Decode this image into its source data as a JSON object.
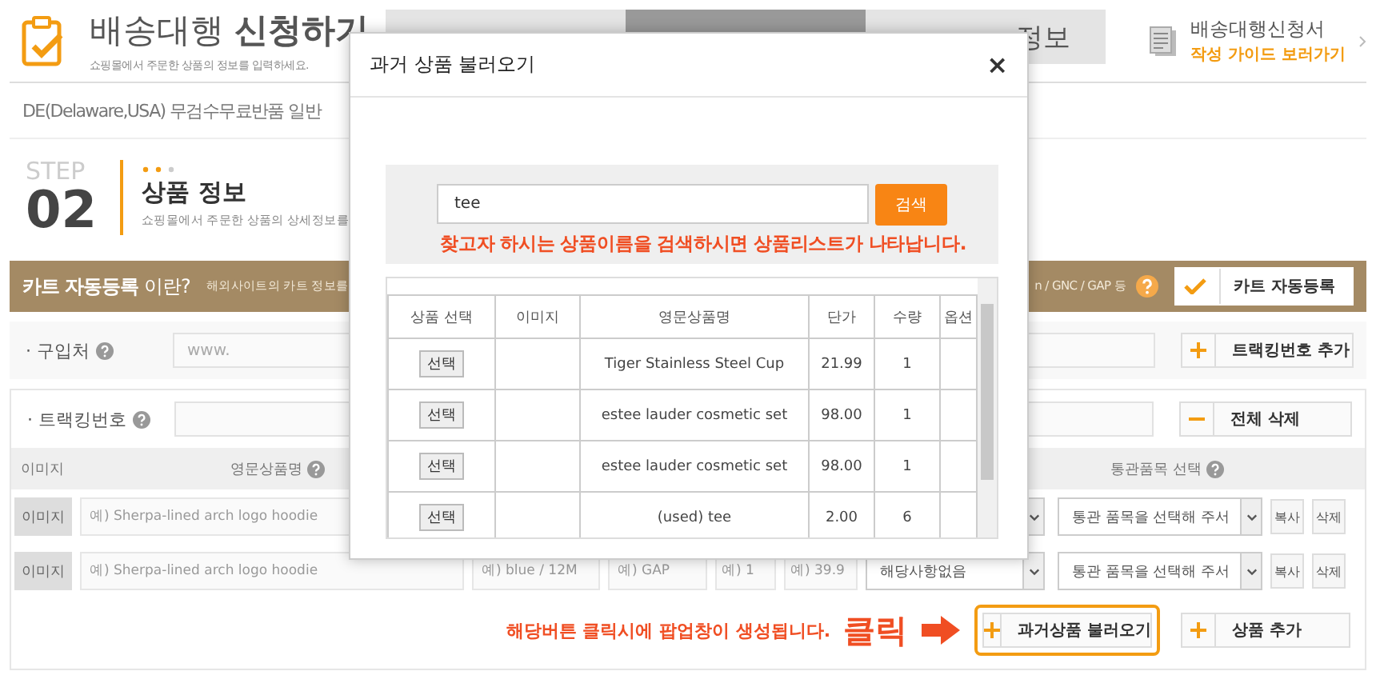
{
  "header": {
    "title": "배송대행 **신청하기**",
    "subtitle": "쇼핑몰에서 주문한 상품의 정보를 입력하세요."
  },
  "steps": [
    {
      "selected": false
    },
    {
      "selected": true
    },
    {
      "selected": false,
      "label": "정보"
    }
  ],
  "guide": {
    "title": "배송대행신청서",
    "link": "작성 가이드 보러가기"
  },
  "notice": "DE(Delaware,USA) 무검수무료반품 일반",
  "step": {
    "label": "STEP",
    "number": "02",
    "title": "상품 정보",
    "desc": "쇼핑몰에서 주문한 상품의 상세정보를"
  },
  "cart_bar": {
    "title": "**카트 자동등록** 이란?",
    "desc": "해외사이트의 카트 정보를",
    "sites": "n / GNC / GAP 등",
    "button": "카트 자동등록"
  },
  "store": {
    "label": "· 구입처",
    "placeholder": "www.",
    "button": "트랙킹번호 추가"
  },
  "tracking": {
    "label": "· 트랙킹번호",
    "button": "전체 삭제"
  },
  "columns": [
    "이미지",
    "영문상품명",
    "통관품목 선택"
  ],
  "products": [
    {
      "image_button": "이미지",
      "name_placeholder": "예) Sherpa-lined arch logo hoodie",
      "customs": "통관 품목을 선택해 주서",
      "copy": "복사",
      "delete": "삭제"
    },
    {
      "image_button": "이미지",
      "name_placeholder": "예) Sherpa-lined arch logo hoodie",
      "option_placeholder": "예) blue / 12M",
      "brand_placeholder": "예) GAP",
      "qty_placeholder": "예) 1",
      "price_placeholder": "예) 39.9",
      "extra": "해당사항없음",
      "customs": "통관 품목을 선택해 주서",
      "copy": "복사",
      "delete": "삭제"
    }
  ],
  "annotation": {
    "text": "해당버튼 클릭시에 팝업창이 생성됩니다.",
    "click": "클릭"
  },
  "actions": [
    {
      "label": "과거상품 불러오기",
      "highlighted": true
    },
    {
      "label": "상품 추가",
      "highlighted": false
    }
  ],
  "modal": {
    "title": "과거 상품 불러오기",
    "close": "×",
    "search_value": "tee",
    "search_button": "검색",
    "hint": "찾고자 하시는 상품이름을 검색하시면 상품리스트가 나타납니다.",
    "columns": [
      "상품 선택",
      "이미지",
      "영문상품명",
      "단가",
      "수량",
      "옵션"
    ],
    "rows": [
      {
        "select": "선택",
        "name": "Tiger Stainless Steel Cup",
        "price": "21.99",
        "qty": "1"
      },
      {
        "select": "선택",
        "name": "estee lauder cosmetic set",
        "price": "98.00",
        "qty": "1"
      },
      {
        "select": "선택",
        "name": "estee lauder cosmetic set",
        "price": "98.00",
        "qty": "1"
      },
      {
        "select": "선택",
        "name": "(used) tee",
        "price": "2.00",
        "qty": "6"
      }
    ]
  }
}
